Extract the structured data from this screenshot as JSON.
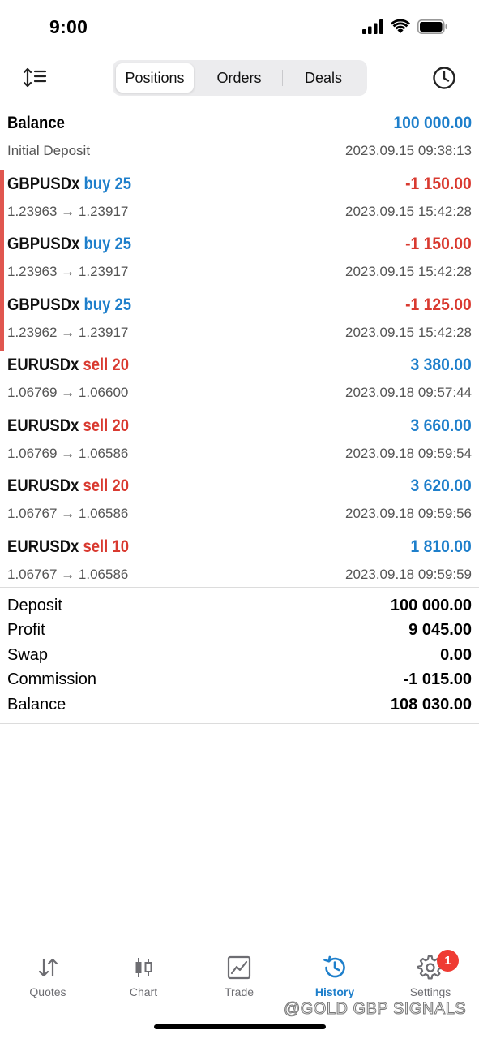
{
  "status_bar": {
    "time": "9:00"
  },
  "toolbar": {
    "tabs": [
      {
        "label": "Positions",
        "active": true
      },
      {
        "label": "Orders",
        "active": false
      },
      {
        "label": "Deals",
        "active": false
      }
    ]
  },
  "balance_header": {
    "label": "Balance",
    "value": "100 000.00",
    "sub_label": "Initial Deposit",
    "timestamp": "2023.09.15 09:38:13"
  },
  "deals": [
    {
      "symbol": "GBPUSDx",
      "side": "buy 25",
      "prices": "1.23963 → 1.23917",
      "profit": "-1 150.00",
      "time": "2023.09.15 15:42:28",
      "profit_color": "red",
      "side_color": "blue",
      "marker": true
    },
    {
      "symbol": "GBPUSDx",
      "side": "buy 25",
      "prices": "1.23963 → 1.23917",
      "profit": "-1 150.00",
      "time": "2023.09.15 15:42:28",
      "profit_color": "red",
      "side_color": "blue",
      "marker": true
    },
    {
      "symbol": "GBPUSDx",
      "side": "buy 25",
      "prices": "1.23962 → 1.23917",
      "profit": "-1 125.00",
      "time": "2023.09.15 15:42:28",
      "profit_color": "red",
      "side_color": "blue",
      "marker": true
    },
    {
      "symbol": "EURUSDx",
      "side": "sell 20",
      "prices": "1.06769 → 1.06600",
      "profit": "3 380.00",
      "time": "2023.09.18 09:57:44",
      "profit_color": "blue",
      "side_color": "red",
      "marker": false
    },
    {
      "symbol": "EURUSDx",
      "side": "sell 20",
      "prices": "1.06769 → 1.06586",
      "profit": "3 660.00",
      "time": "2023.09.18 09:59:54",
      "profit_color": "blue",
      "side_color": "red",
      "marker": false
    },
    {
      "symbol": "EURUSDx",
      "side": "sell 20",
      "prices": "1.06767 → 1.06586",
      "profit": "3 620.00",
      "time": "2023.09.18 09:59:56",
      "profit_color": "blue",
      "side_color": "red",
      "marker": false
    },
    {
      "symbol": "EURUSDx",
      "side": "sell 10",
      "prices": "1.06767 → 1.06586",
      "profit": "1 810.00",
      "time": "2023.09.18 09:59:59",
      "profit_color": "blue",
      "side_color": "red",
      "marker": false
    }
  ],
  "summary": [
    {
      "label": "Deposit",
      "value": "100 000.00"
    },
    {
      "label": "Profit",
      "value": "9 045.00"
    },
    {
      "label": "Swap",
      "value": "0.00"
    },
    {
      "label": "Commission",
      "value": "-1 015.00"
    },
    {
      "label": "Balance",
      "value": "108 030.00"
    }
  ],
  "tabbar": {
    "items": [
      {
        "label": "Quotes",
        "icon": "quotes-arrows-icon",
        "active": false
      },
      {
        "label": "Chart",
        "icon": "candlestick-icon",
        "active": false
      },
      {
        "label": "Trade",
        "icon": "trade-chart-icon",
        "active": false
      },
      {
        "label": "History",
        "icon": "history-clock-icon",
        "active": true
      },
      {
        "label": "Settings",
        "icon": "gear-icon",
        "active": false
      }
    ],
    "settings_badge": "1"
  },
  "watermark": "@GOLD GBP SIGNALS",
  "colors": {
    "accent_blue": "#1e7fcb",
    "loss_red": "#d93a30",
    "marker_red": "#e0564f",
    "badge_red": "#ef3b33"
  }
}
